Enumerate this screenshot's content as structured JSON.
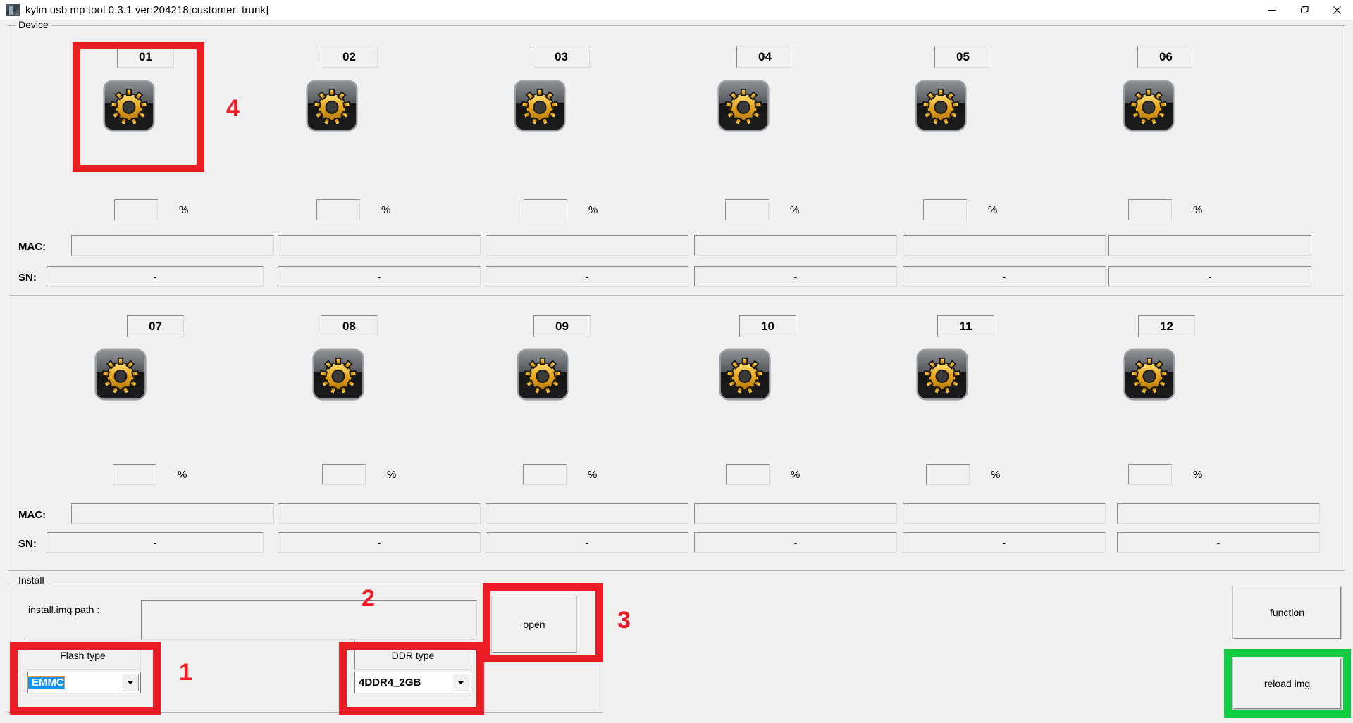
{
  "window": {
    "title": "kylin usb mp tool 0.3.1 ver:204218[customer: trunk]",
    "app_icon": "app-icon",
    "controls": {
      "minimize": "minimize-icon",
      "restore": "restore-icon",
      "close": "close-icon"
    }
  },
  "device_group": {
    "title": "Device",
    "mac_label": "MAC:",
    "sn_label": "SN:",
    "percent_symbol": "%",
    "device_icon_name": "gear-device-icon",
    "rows": [
      {
        "devices": [
          {
            "id": "01",
            "percent": "",
            "mac": "",
            "sn": "-"
          },
          {
            "id": "02",
            "percent": "",
            "mac": "",
            "sn": "-"
          },
          {
            "id": "03",
            "percent": "",
            "mac": "",
            "sn": "-"
          },
          {
            "id": "04",
            "percent": "",
            "mac": "",
            "sn": "-"
          },
          {
            "id": "05",
            "percent": "",
            "mac": "",
            "sn": "-"
          },
          {
            "id": "06",
            "percent": "",
            "mac": "",
            "sn": "-"
          }
        ]
      },
      {
        "devices": [
          {
            "id": "07",
            "percent": "",
            "mac": "",
            "sn": "-"
          },
          {
            "id": "08",
            "percent": "",
            "mac": "",
            "sn": "-"
          },
          {
            "id": "09",
            "percent": "",
            "mac": "",
            "sn": "-"
          },
          {
            "id": "10",
            "percent": "",
            "mac": "",
            "sn": "-"
          },
          {
            "id": "11",
            "percent": "",
            "mac": "",
            "sn": "-"
          },
          {
            "id": "12",
            "percent": "",
            "mac": "",
            "sn": "-"
          }
        ]
      }
    ]
  },
  "install_group": {
    "title": "Install",
    "path_label": "install.img path :",
    "path_value": "",
    "open_button": "open",
    "flash_type_label": "Flash type",
    "flash_type_value": "EMMC",
    "ddr_type_label": "DDR type",
    "ddr_type_value": "4DDR4_2GB"
  },
  "side_buttons": {
    "function": "function",
    "reload_img": "reload img"
  },
  "annotations": {
    "colors": {
      "red": "#ec1c24",
      "green": "#11cc3e"
    },
    "markers": [
      {
        "number": "1",
        "target": "flash-type-section"
      },
      {
        "number": "2",
        "target": "install-img-path-input"
      },
      {
        "number": "3",
        "target": "open-button"
      },
      {
        "number": "4",
        "target": "device-01"
      }
    ]
  }
}
